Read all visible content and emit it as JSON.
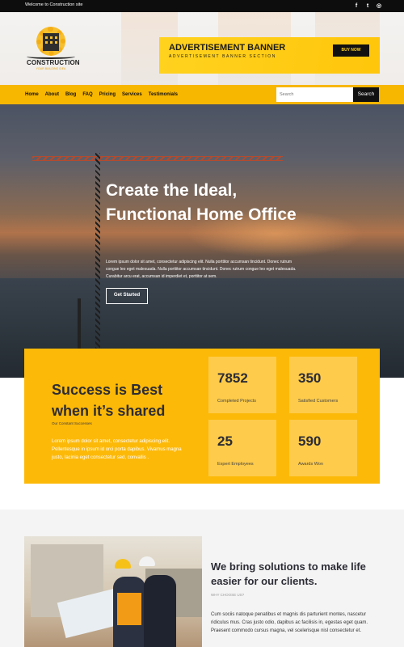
{
  "topbar": {
    "welcome": "Welcome to Construction site",
    "social": [
      {
        "icon": "facebook-icon",
        "glyph": "f"
      },
      {
        "icon": "twitter-icon",
        "glyph": "t"
      },
      {
        "icon": "instagram-icon",
        "glyph": "◎"
      }
    ]
  },
  "logo": {
    "name": "CONSTRUCTION",
    "tagline": "YOUR BUILDING IDEA"
  },
  "ad": {
    "title": "ADVERTISEMENT BANNER",
    "subtitle": "ADVERTISEMENT BANNER SECTION",
    "button": "BUY NOW"
  },
  "nav": {
    "items": [
      "Home",
      "About",
      "Blog",
      "FAQ",
      "Pricing",
      "Services",
      "Testimonials"
    ],
    "search_placeholder": "Search",
    "search_button": "Search"
  },
  "hero": {
    "title": "Create the Ideal, Functional Home Office",
    "lead": "Lorem ipsum dolor sit amet, consectetur adipiscing elit. Nulla porttitor accumsan tincidunt. Donec rutrum congue leo eget malesuada. Nulla porttitor accumsan tincidunt. Donec rutrum congue leo eget malesuada. Curabitur arcu erat, accumsan id imperdiet et, porttitor at sem.",
    "button": "Get Started"
  },
  "stats": {
    "title": "Success is Best when it’s shared",
    "subtitle": "Our Constant Successes",
    "paragraph": "Lorem ipsum dolor sit amet, consectetur adipiscing elit. Pellentesque in ipsum id orci porta dapibus. Vivamus magna justo, lacinia eget consectetur sed, convallis .",
    "items": [
      {
        "value": "7852",
        "label": "Completed Projects"
      },
      {
        "value": "350",
        "label": "Satisfied Customers"
      },
      {
        "value": "25",
        "label": "Expert Employees"
      },
      {
        "value": "590",
        "label": "Awards Won"
      }
    ]
  },
  "why": {
    "heading": "We bring solutions to make life easier for our clients.",
    "subtitle": "WHY CHOOSE US?",
    "paragraph": "Cum sociis natoque penatibus et magnis dis parturient montes, nascetur ridiculus mus. Cras justo odio, dapibus ac facilisis in, egestas eget quam. Praesent commodo cursus magna, vel scelerisque nisl consectetur et."
  },
  "colors": {
    "accent": "#fdb908",
    "dark": "#2c2c36",
    "topbar": "#0d0d0d"
  }
}
